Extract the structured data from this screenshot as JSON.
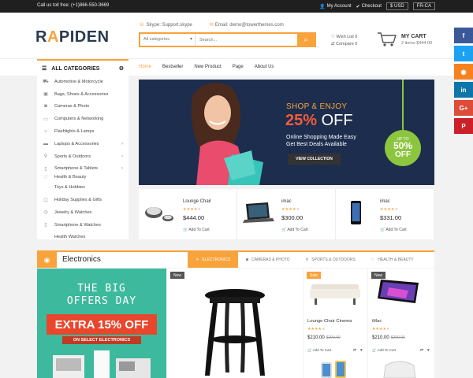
{
  "topbar": {
    "phone": "Call us toll free: (+1)866-550-3669",
    "my_account": "My Account",
    "checkout": "Checkout",
    "currency": "$ USD",
    "language": "FR-CA"
  },
  "header": {
    "logo_pre": "R",
    "logo_accent": "A",
    "logo_post": "PIDEN",
    "skype": "Skype: Support.skype",
    "email": "Email: demo@towerthemes.com",
    "search_category": "All categories",
    "search_placeholder": "Search...",
    "wishlist": "Wish List 0",
    "compare": "Compare 0",
    "cart_title": "MY CART",
    "cart_sub": "2 items $444.00"
  },
  "nav": {
    "all_categories": "ALL CATEGORIES",
    "menu": [
      "Home",
      "Bestseller",
      "New Product",
      "Page",
      "About Us"
    ]
  },
  "sidebar": {
    "items": [
      {
        "label": "Automotive & Motorcycle",
        "icon": "car-icon",
        "arrow": false
      },
      {
        "label": "Bags, Shoes & Accessories",
        "icon": "bag-icon",
        "arrow": false
      },
      {
        "label": "Cameras & Photo",
        "icon": "camera-icon",
        "arrow": false
      },
      {
        "label": "Computers & Networking",
        "icon": "monitor-icon",
        "arrow": false
      },
      {
        "label": "Flashlights & Lamps",
        "icon": "lamp-icon",
        "arrow": false
      },
      {
        "label": "Laptops & Accessories",
        "icon": "laptop-icon",
        "arrow": true
      },
      {
        "label": "Sports & Outdoors",
        "icon": "bike-icon",
        "arrow": true
      },
      {
        "label": "Smartphone & Tablets",
        "icon": "phone-icon",
        "arrow": true
      },
      {
        "label": "Health & Beauty",
        "icon": "heart-icon",
        "arrow": false
      },
      {
        "label": "Toys & Hobbies",
        "icon": "toy-icon",
        "arrow": false
      },
      {
        "label": "Holiday Supplies & Gifts",
        "icon": "gift-icon",
        "arrow": false
      },
      {
        "label": "Jewelry & Watches",
        "icon": "watch-icon",
        "arrow": false
      },
      {
        "label": "Smartphone & Watches",
        "icon": "phone-icon",
        "arrow": false
      },
      {
        "label": "Health Watches",
        "icon": "heart-icon",
        "arrow": false
      }
    ]
  },
  "banner": {
    "shop": "SHOP & ENJOY",
    "pct": "25%",
    "off": "OFF",
    "line1": "Online Shopping Made Easy",
    "line2": "Get Best Deals Available",
    "button": "VIEW COLLECTION",
    "badge_up": "UP TO",
    "badge_pct": "50%",
    "badge_off": "OFF"
  },
  "mini_products": [
    {
      "name": "Lounge Chair",
      "price": "$444.00",
      "add": "Add To Cart",
      "rating": 4
    },
    {
      "name": "imac",
      "price": "$300.00",
      "add": "Add To Cart",
      "rating": 4
    },
    {
      "name": "imac",
      "price": "$331.00",
      "add": "Add To Cart",
      "rating": 4
    }
  ],
  "section": {
    "title": "Electronics",
    "tabs": [
      "ELECTRONICS",
      "CAMERAS & PHOTO",
      "SPORTS & OUTDOORS",
      "HEALTH & BEAUTY"
    ]
  },
  "promo": {
    "line1": "THE BIG",
    "line2": "OFFERS DAY",
    "extra": "EXTRA 15% OFF",
    "sub": "ON SELECT ELECTRONICS"
  },
  "products": [
    {
      "tag": "New"
    },
    {
      "tag": "Sale",
      "name": "Lounge Chair Cinema",
      "price": "$210.00",
      "old": "$290.00",
      "add": "Add To Cart",
      "rating": 4
    },
    {
      "tag": "New",
      "name": "iMac",
      "price": "$210.00",
      "old": "$290.00",
      "add": "Add To Cart",
      "rating": 4
    }
  ],
  "colors": {
    "accent": "#f9a33c",
    "banner": "#1d2d4e",
    "promo": "#3db99d",
    "badge": "#8cc63f"
  },
  "social": [
    {
      "icon": "facebook-icon",
      "glyph": "f",
      "color": "#3b5998"
    },
    {
      "icon": "twitter-icon",
      "glyph": "t",
      "color": "#1da1f2"
    },
    {
      "icon": "rss-icon",
      "glyph": "◉",
      "color": "#f58220"
    },
    {
      "icon": "linkedin-icon",
      "glyph": "in",
      "color": "#0e76a8"
    },
    {
      "icon": "google-plus-icon",
      "glyph": "G+",
      "color": "#dd4b39"
    },
    {
      "icon": "pinterest-icon",
      "glyph": "P",
      "color": "#cb2027"
    }
  ]
}
